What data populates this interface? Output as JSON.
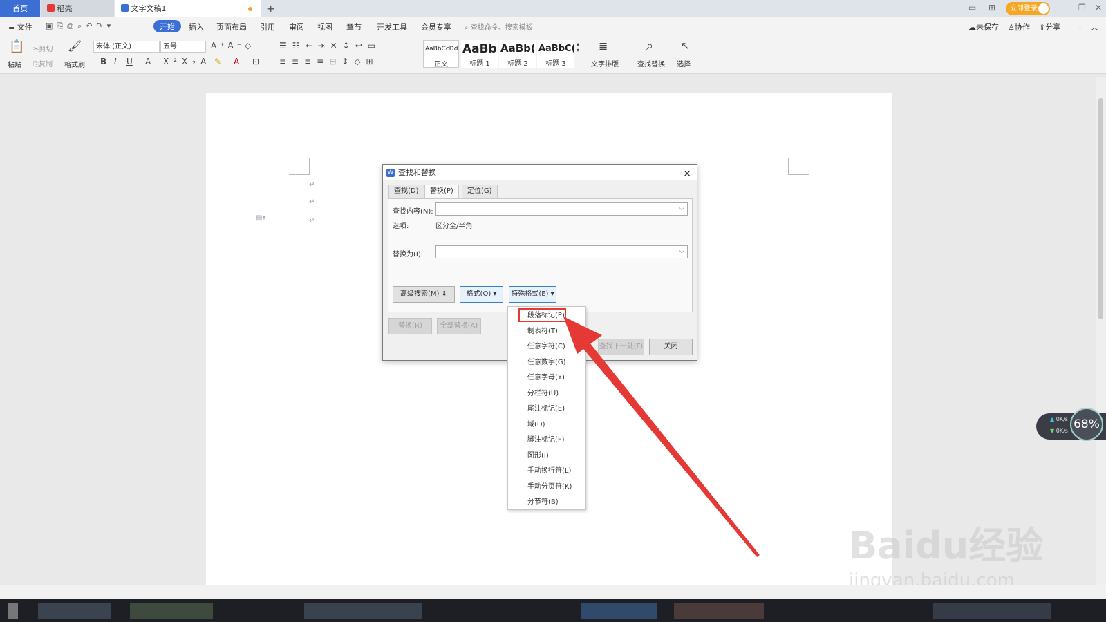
{
  "tabs": {
    "home": "首页",
    "daoke": "稻壳",
    "doc": "文字文稿1",
    "new_tab": "+"
  },
  "titlebar": {
    "login": "立即登录",
    "minimize": "—",
    "restore": "❐",
    "close": "✕"
  },
  "menu": {
    "file": "文件",
    "start": "开始",
    "insert": "插入",
    "layout": "页面布局",
    "reference": "引用",
    "review": "审阅",
    "view": "视图",
    "chapter": "章节",
    "devtools": "开发工具",
    "member": "会员专享",
    "search_placeholder": "查找命令、搜索模板",
    "unsaved": "未保存",
    "collab": "协作",
    "share": "分享"
  },
  "ribbon": {
    "paste": "粘贴",
    "cut": "剪切",
    "copy": "复制",
    "format_painter": "格式刷",
    "font_name": "宋体 (正文)",
    "font_size": "五号",
    "bold": "B",
    "italic": "I",
    "underline": "U",
    "styles": [
      {
        "preview": "AaBbCcDd",
        "name": "正文"
      },
      {
        "preview": "AaBb",
        "name": "标题 1"
      },
      {
        "preview": "AaBb(",
        "name": "标题 2"
      },
      {
        "preview": "AaBbC(",
        "name": "标题 3"
      }
    ],
    "text_layout": "文字排版",
    "find_replace": "查找替换",
    "select": "选择"
  },
  "document": {
    "paragraph_mark": "↵"
  },
  "dialog": {
    "title": "查找和替换",
    "logo": "W",
    "close": "✕",
    "tabs": {
      "find": "查找(D)",
      "replace": "替换(P)",
      "goto": "定位(G)"
    },
    "find_label": "查找内容(N):",
    "find_value": "",
    "options_label": "选项:",
    "options_value": "区分全/半角",
    "replace_label": "替换为(I):",
    "replace_value": "",
    "advanced_btn": "高级搜索(M) ⇕",
    "format_btn": "格式(O) ▾",
    "special_btn": "特殊格式(E) ▾",
    "replace_btn": "替换(R)",
    "replace_all_btn": "全部替换(A)",
    "find_next_btn": "查找下一处(F)",
    "close_btn": "关闭"
  },
  "special_menu": [
    "段落标记(P)",
    "制表符(T)",
    "任意字符(C)",
    "任意数字(G)",
    "任意字母(Y)",
    "分栏符(U)",
    "尾注标记(E)",
    "域(D)",
    "脚注标记(F)",
    "图形(I)",
    "手动换行符(L)",
    "手动分页符(K)",
    "分节符(B)"
  ],
  "network": {
    "up": "0K/s",
    "down": "0K/s",
    "percent": "68%"
  },
  "watermark": {
    "main": "Baidu经验",
    "sub": "jingyan.baidu.com"
  },
  "colors": {
    "accent": "#3b6fd4",
    "arrow": "#e53935",
    "highlight": "#e53935"
  }
}
